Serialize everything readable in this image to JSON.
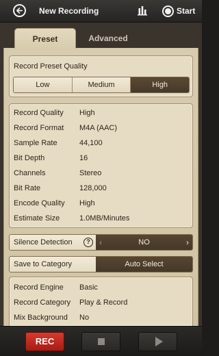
{
  "header": {
    "title": "New Recording",
    "start_label": "Start",
    "back_icon": "back-arrow-icon",
    "chart_icon": "bar-chart-icon",
    "record_icon": "record-circle-icon"
  },
  "tabs": [
    {
      "label": "Preset",
      "selected": true
    },
    {
      "label": "Advanced",
      "selected": false
    }
  ],
  "preset_quality": {
    "title": "Record Preset Quality",
    "options": [
      "Low",
      "Medium",
      "High"
    ],
    "selected": "High"
  },
  "details": [
    {
      "label": "Record Quality",
      "value": "High"
    },
    {
      "label": "Record Format",
      "value": "M4A (AAC)"
    },
    {
      "label": "Sample Rate",
      "value": "44,100"
    },
    {
      "label": "Bit Depth",
      "value": "16"
    },
    {
      "label": "Channels",
      "value": "Stereo"
    },
    {
      "label": "Bit Rate",
      "value": "128,000"
    },
    {
      "label": "Encode Quality",
      "value": "High"
    },
    {
      "label": "Estimate Size",
      "value": "1.0MB/Minutes"
    }
  ],
  "silence_detection": {
    "label": "Silence Detection",
    "help": "?",
    "value": "NO",
    "prev": "‹",
    "next": "›"
  },
  "save_category": {
    "label": "Save to Category",
    "value": "Auto Select"
  },
  "engine": [
    {
      "label": "Record Engine",
      "value": "Basic"
    },
    {
      "label": "Record Category",
      "value": "Play & Record"
    },
    {
      "label": "Mix Background",
      "value": "No"
    }
  ],
  "controls": {
    "rec_label": "REC"
  },
  "colors": {
    "accent_dark": "#4f412f",
    "paper": "#e6dcc3",
    "rec_red": "#c02a20"
  }
}
